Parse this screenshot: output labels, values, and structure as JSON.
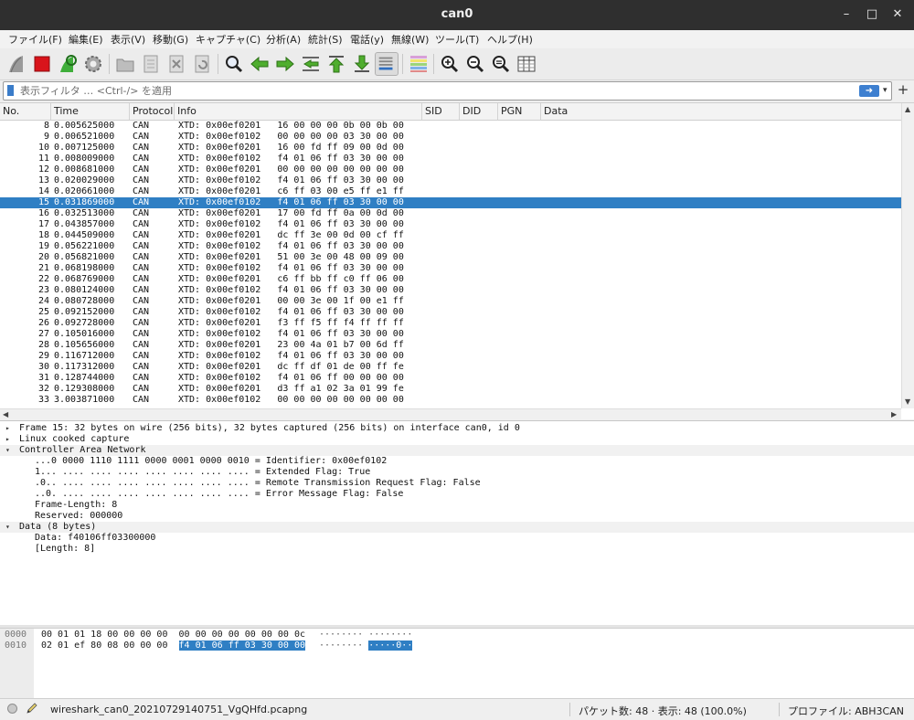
{
  "window": {
    "title": "can0"
  },
  "menu": [
    "ファイル(F)",
    "編集(E)",
    "表示(V)",
    "移動(G)",
    "キャプチャ(C)",
    "分析(A)",
    "統計(S)",
    "電話(y)",
    "無線(W)",
    "ツール(T)",
    "ヘルプ(H)"
  ],
  "toolbar": {
    "icons": [
      "shark-fin-start-icon",
      "stop-capture-icon",
      "restart-capture-icon",
      "capture-options-gear-icon",
      "open-file-icon",
      "save-file-icon",
      "close-file-icon",
      "reload-file-icon",
      "find-packet-icon",
      "go-back-icon",
      "go-forward-icon",
      "go-to-packet-icon",
      "go-first-icon",
      "go-last-icon",
      "autoscroll-icon",
      "colorize-icon",
      "zoom-in-icon",
      "zoom-out-icon",
      "zoom-normal-icon",
      "resize-columns-icon"
    ]
  },
  "filter": {
    "placeholder": "表示フィルタ … <Ctrl-/> を適用",
    "apply_icon": "arrow-right-icon"
  },
  "packet_list": {
    "columns": [
      "No.",
      "Time",
      "Protocol",
      "Info",
      "SID",
      "DID",
      "PGN",
      "Data"
    ],
    "selected_no": "15",
    "rows": [
      {
        "no": "8",
        "time": "0.005625000",
        "proto": "CAN",
        "info": "XTD: 0x00ef0201   16 00 00 00 0b 00 0b 00"
      },
      {
        "no": "9",
        "time": "0.006521000",
        "proto": "CAN",
        "info": "XTD: 0x00ef0102   00 00 00 00 03 30 00 00"
      },
      {
        "no": "10",
        "time": "0.007125000",
        "proto": "CAN",
        "info": "XTD: 0x00ef0201   16 00 fd ff 09 00 0d 00"
      },
      {
        "no": "11",
        "time": "0.008009000",
        "proto": "CAN",
        "info": "XTD: 0x00ef0102   f4 01 06 ff 03 30 00 00"
      },
      {
        "no": "12",
        "time": "0.008681000",
        "proto": "CAN",
        "info": "XTD: 0x00ef0201   00 00 00 00 00 00 00 00"
      },
      {
        "no": "13",
        "time": "0.020029000",
        "proto": "CAN",
        "info": "XTD: 0x00ef0102   f4 01 06 ff 03 30 00 00"
      },
      {
        "no": "14",
        "time": "0.020661000",
        "proto": "CAN",
        "info": "XTD: 0x00ef0201   c6 ff 03 00 e5 ff e1 ff"
      },
      {
        "no": "15",
        "time": "0.031869000",
        "proto": "CAN",
        "info": "XTD: 0x00ef0102   f4 01 06 ff 03 30 00 00"
      },
      {
        "no": "16",
        "time": "0.032513000",
        "proto": "CAN",
        "info": "XTD: 0x00ef0201   17 00 fd ff 0a 00 0d 00"
      },
      {
        "no": "17",
        "time": "0.043857000",
        "proto": "CAN",
        "info": "XTD: 0x00ef0102   f4 01 06 ff 03 30 00 00"
      },
      {
        "no": "18",
        "time": "0.044509000",
        "proto": "CAN",
        "info": "XTD: 0x00ef0201   dc ff 3e 00 0d 00 cf ff"
      },
      {
        "no": "19",
        "time": "0.056221000",
        "proto": "CAN",
        "info": "XTD: 0x00ef0102   f4 01 06 ff 03 30 00 00"
      },
      {
        "no": "20",
        "time": "0.056821000",
        "proto": "CAN",
        "info": "XTD: 0x00ef0201   51 00 3e 00 48 00 09 00"
      },
      {
        "no": "21",
        "time": "0.068198000",
        "proto": "CAN",
        "info": "XTD: 0x00ef0102   f4 01 06 ff 03 30 00 00"
      },
      {
        "no": "22",
        "time": "0.068769000",
        "proto": "CAN",
        "info": "XTD: 0x00ef0201   c6 ff bb ff c0 ff 06 00"
      },
      {
        "no": "23",
        "time": "0.080124000",
        "proto": "CAN",
        "info": "XTD: 0x00ef0102   f4 01 06 ff 03 30 00 00"
      },
      {
        "no": "24",
        "time": "0.080728000",
        "proto": "CAN",
        "info": "XTD: 0x00ef0201   00 00 3e 00 1f 00 e1 ff"
      },
      {
        "no": "25",
        "time": "0.092152000",
        "proto": "CAN",
        "info": "XTD: 0x00ef0102   f4 01 06 ff 03 30 00 00"
      },
      {
        "no": "26",
        "time": "0.092728000",
        "proto": "CAN",
        "info": "XTD: 0x00ef0201   f3 ff f5 ff f4 ff ff ff"
      },
      {
        "no": "27",
        "time": "0.105016000",
        "proto": "CAN",
        "info": "XTD: 0x00ef0102   f4 01 06 ff 03 30 00 00"
      },
      {
        "no": "28",
        "time": "0.105656000",
        "proto": "CAN",
        "info": "XTD: 0x00ef0201   23 00 4a 01 b7 00 6d ff"
      },
      {
        "no": "29",
        "time": "0.116712000",
        "proto": "CAN",
        "info": "XTD: 0x00ef0102   f4 01 06 ff 03 30 00 00"
      },
      {
        "no": "30",
        "time": "0.117312000",
        "proto": "CAN",
        "info": "XTD: 0x00ef0201   dc ff df 01 de 00 ff fe"
      },
      {
        "no": "31",
        "time": "0.128744000",
        "proto": "CAN",
        "info": "XTD: 0x00ef0102   f4 01 06 ff 00 00 00 00"
      },
      {
        "no": "32",
        "time": "0.129308000",
        "proto": "CAN",
        "info": "XTD: 0x00ef0201   d3 ff a1 02 3a 01 99 fe"
      },
      {
        "no": "33",
        "time": "3.003871000",
        "proto": "CAN",
        "info": "XTD: 0x00ef0102   00 00 00 00 00 00 00 00"
      }
    ]
  },
  "details": {
    "lines": [
      {
        "kind": "collapsed",
        "text": "Frame 15: 32 bytes on wire (256 bits), 32 bytes captured (256 bits) on interface can0, id 0"
      },
      {
        "kind": "collapsed",
        "text": "Linux cooked capture"
      },
      {
        "kind": "expanded",
        "text": "Controller Area Network"
      },
      {
        "kind": "child",
        "text": "...0 0000 1110 1111 0000 0001 0000 0010 = Identifier: 0x00ef0102"
      },
      {
        "kind": "child",
        "text": "1... .... .... .... .... .... .... .... = Extended Flag: True"
      },
      {
        "kind": "child",
        "text": ".0.. .... .... .... .... .... .... .... = Remote Transmission Request Flag: False"
      },
      {
        "kind": "child",
        "text": "..0. .... .... .... .... .... .... .... = Error Message Flag: False"
      },
      {
        "kind": "child",
        "text": "Frame-Length: 8"
      },
      {
        "kind": "child",
        "text": "Reserved: 000000"
      },
      {
        "kind": "expanded",
        "text": "Data (8 bytes)"
      },
      {
        "kind": "child",
        "text": "Data: f40106ff03300000"
      },
      {
        "kind": "child",
        "text": "[Length: 8]"
      }
    ]
  },
  "bytes": {
    "rows": [
      {
        "offset": "0000",
        "hex": "00 01 01 18 00 00 00 00  00 00 00 00 00 00 00 0c",
        "hex_hl": "",
        "ascii": "········ ········",
        "ascii_hl": ""
      },
      {
        "offset": "0010",
        "hex": "02 01 ef 80 08 00 00 00  ",
        "hex_hl": "f4 01 06 ff 03 30 00 00",
        "ascii": "········ ",
        "ascii_hl": "·····0··"
      }
    ]
  },
  "status": {
    "file": "wireshark_can0_20210729140751_VgQHfd.pcapng",
    "packets": "パケット数: 48 · 表示: 48 (100.0%)",
    "profile": "プロファイル: ABH3CAN"
  }
}
